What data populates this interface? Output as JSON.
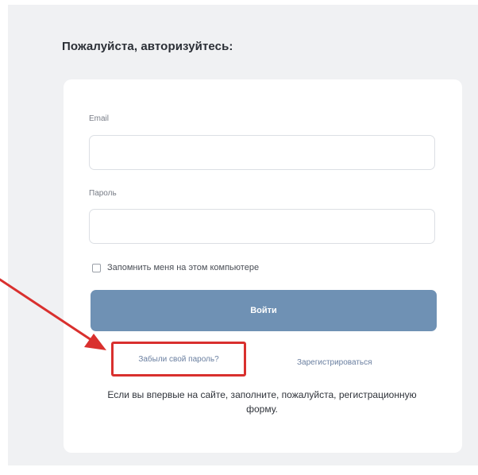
{
  "page": {
    "heading": "Пожалуйста, авторизуйтесь:"
  },
  "form": {
    "email_label": "Email",
    "email_value": "",
    "password_label": "Пароль",
    "password_value": "",
    "remember_label": "Запомнить меня на этом компьютере",
    "remember_checked": false,
    "login_label": "Войти",
    "forgot_label": "Забыли свой пароль?",
    "register_label": "Зарегистрироваться",
    "hint": "Если вы впервые на сайте, заполните, пожалуйста, регистрационную форму."
  },
  "annotation": {
    "highlight_color": "#d9302e",
    "arrow_color": "#d9302e",
    "highlight_target": "forgot-password-link"
  },
  "colors": {
    "button": "#6f91b4",
    "link": "#6a7fa0",
    "background": "#f0f1f3"
  }
}
